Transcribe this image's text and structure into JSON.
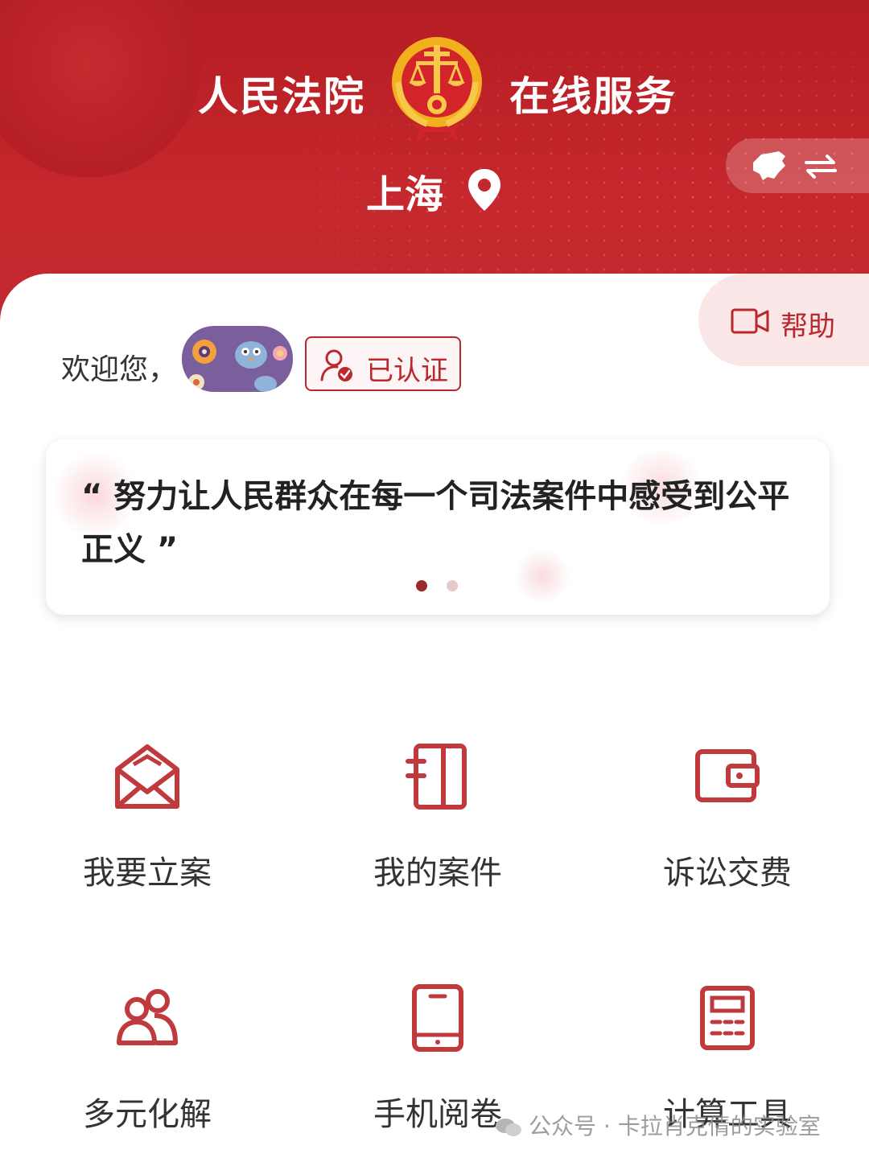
{
  "header": {
    "title_left": "人民法院",
    "title_right": "在线服务",
    "city": "上海",
    "emblem_icon": "court-emblem",
    "location_icon": "location-pin-icon",
    "switch_icons": [
      "china-map-icon",
      "swap-arrows-icon"
    ],
    "background_color": "#b81f25"
  },
  "help": {
    "label": "帮助",
    "icon": "video-camera-icon"
  },
  "user": {
    "welcome_text": "欢迎您，",
    "verified_label": "已认证",
    "verified_icon": "user-check-icon"
  },
  "quote": {
    "text": "“ 努力让人民群众在每一个司法案件中感受到公平正义 ”",
    "page_count": 2,
    "active_page": 1
  },
  "services": [
    {
      "label": "我要立案",
      "icon": "envelope-open-icon"
    },
    {
      "label": "我的案件",
      "icon": "notebook-icon"
    },
    {
      "label": "诉讼交费",
      "icon": "wallet-icon"
    },
    {
      "label": "多元化解",
      "icon": "users-icon"
    },
    {
      "label": "手机阅卷",
      "icon": "mobile-phone-icon"
    },
    {
      "label": "计算工具",
      "icon": "calculator-icon"
    }
  ],
  "watermark": {
    "text": "公众号 · 卡拉肖克倩的实验室",
    "icon": "wechat-icon"
  },
  "colors": {
    "accent": "#b8282d",
    "icon_stroke": "#c0393c",
    "help_bg": "#fbe6e8"
  }
}
